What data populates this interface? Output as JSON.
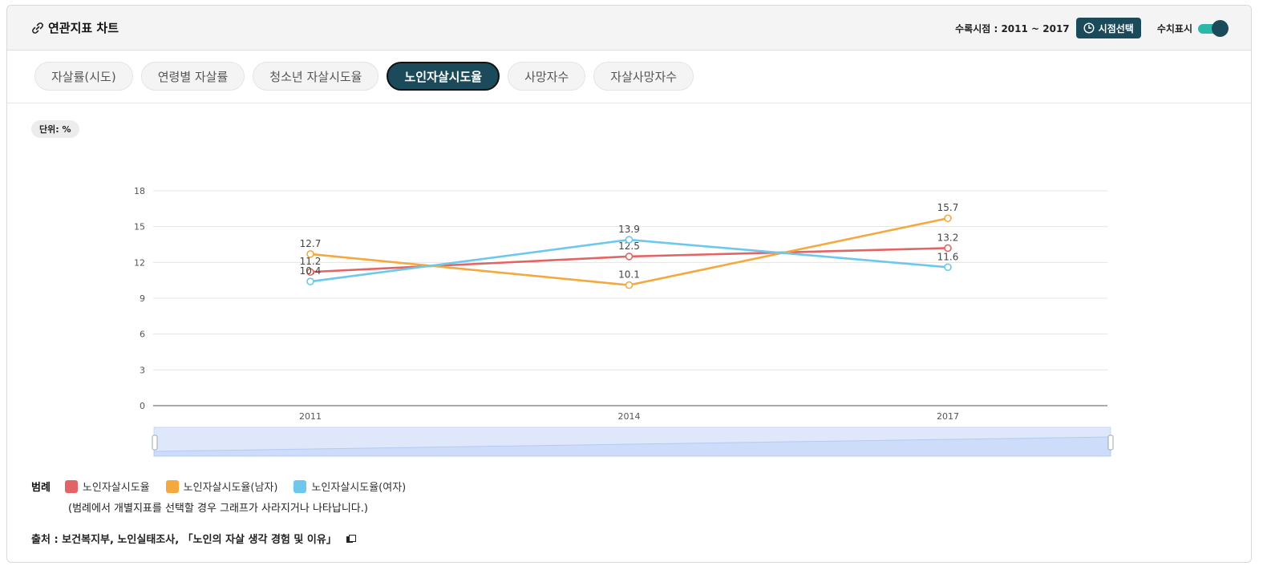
{
  "header": {
    "title": "연관지표 차트",
    "period_text": "수록시점 : 2011 ~ 2017",
    "period_button": "시점선택",
    "toggle_label": "수치표시",
    "toggle_on": true
  },
  "tabs": [
    {
      "label": "자살률(시도)",
      "active": false
    },
    {
      "label": "연령별 자살률",
      "active": false
    },
    {
      "label": "청소년 자살시도율",
      "active": false
    },
    {
      "label": "노인자살시도율",
      "active": true
    },
    {
      "label": "사망자수",
      "active": false
    },
    {
      "label": "자살사망자수",
      "active": false
    }
  ],
  "unit": "단위: %",
  "legend": {
    "title": "범례",
    "note": "(범례에서 개별지표를 선택할 경우 그래프가 사라지거나 나타납니다.)"
  },
  "source": "출처 : 보건복지부, 노인실태조사, 「노인의 자살 생각 경험 및 이유」",
  "colors": {
    "accent": "#1b4a5a",
    "toggle_track": "#2cb8a8"
  },
  "chart_data": {
    "type": "line",
    "categories": [
      "2011",
      "2014",
      "2017"
    ],
    "yticks": [
      0,
      3,
      6,
      9,
      12,
      15,
      18
    ],
    "ylim": [
      0,
      18
    ],
    "grid": true,
    "show_values": true,
    "series": [
      {
        "name": "노인자살시도율",
        "values": [
          11.2,
          12.5,
          13.2
        ],
        "color": "#e36464"
      },
      {
        "name": "노인자살시도율(남자)",
        "values": [
          12.7,
          10.1,
          15.7
        ],
        "color": "#f4a83e"
      },
      {
        "name": "노인자살시도율(여자)",
        "values": [
          10.4,
          13.9,
          11.6
        ],
        "color": "#6cc8ec"
      }
    ]
  }
}
